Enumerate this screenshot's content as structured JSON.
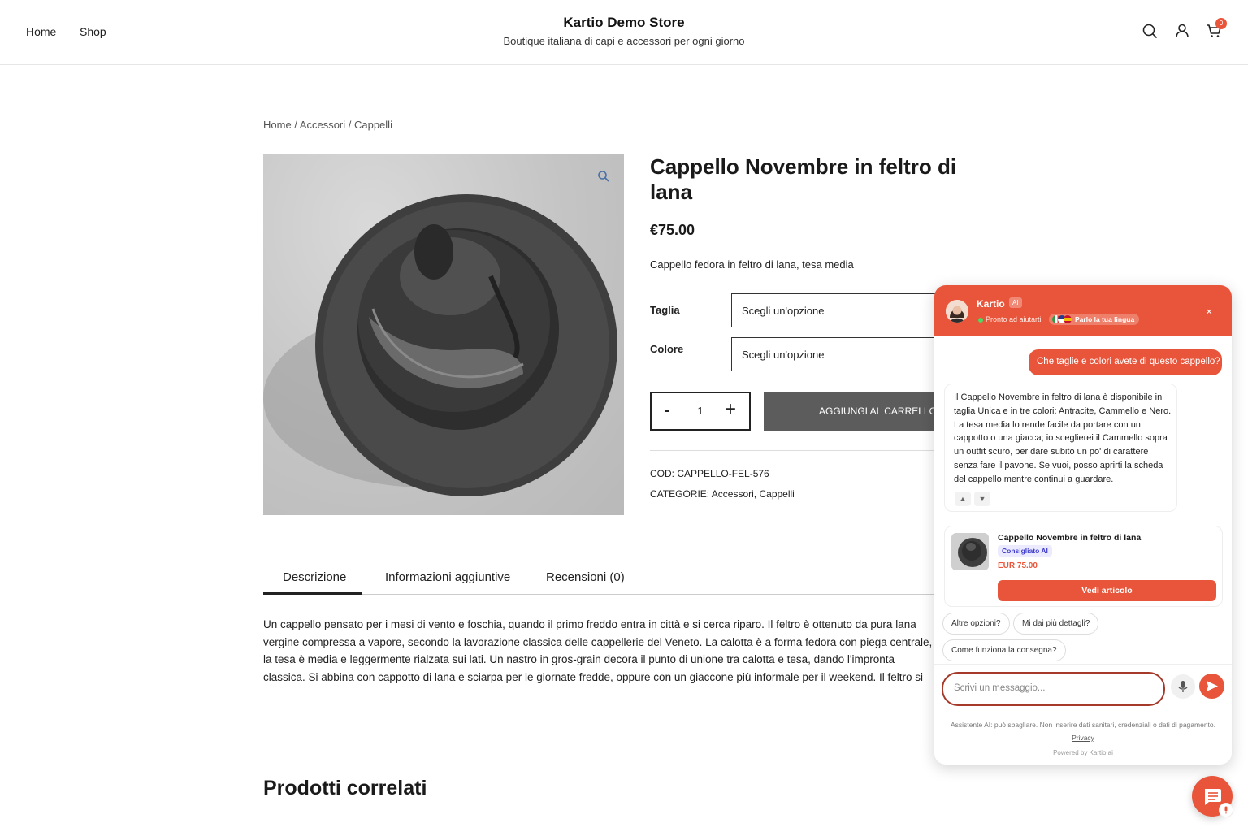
{
  "header": {
    "nav": [
      "Home",
      "Shop"
    ],
    "store_title": "Kartio Demo Store",
    "store_tagline": "Boutique italiana di capi e accessori per ogni giorno",
    "cart_count": "0"
  },
  "breadcrumb": "Home / Accessori / Cappelli",
  "product": {
    "title": "Cappello Novembre in feltro di lana",
    "price": "€75.00",
    "short_description": "Cappello fedora in feltro di lana, tesa media",
    "attributes": [
      {
        "label": "Taglia",
        "value": "Scegli un'opzione"
      },
      {
        "label": "Colore",
        "value": "Scegli un'opzione"
      }
    ],
    "quantity": "1",
    "qty_minus": "-",
    "qty_plus": "+",
    "add_to_cart": "AGGIUNGI AL CARRELLO",
    "sku_line": "COD: CAPPELLO-FEL-576",
    "categories_line": "CATEGORIE: Accessori, Cappelli"
  },
  "tabs": [
    "Descrizione",
    "Informazioni aggiuntive",
    "Recensioni (0)"
  ],
  "description_text": "Un cappello pensato per i mesi di vento e foschia, quando il primo freddo entra in città e si cerca riparo. Il feltro è ottenuto da pura lana vergine compressa a vapore, secondo la lavorazione classica delle cappellerie del Veneto. La calotta è a forma fedora con piega centrale, la tesa è media e leggermente rialzata sui lati. Un nastro in gros-grain decora il punto di unione tra calotta e tesa, dando l'impronta classica. Si abbina con cappotto di lana e sciarpa per le giornate fredde, oppure con un giaccone più informale per il weekend. Il feltro si modella sulla testa con il tempo, rendendolo ogni stagione più adatto.",
  "related_title": "Prodotti correlati",
  "chat": {
    "bot_name": "Kartio",
    "ai_tag": "AI",
    "status": "Pronto ad aiutarti",
    "lang_pill": "Parlo la tua lingua",
    "close": "×",
    "user_message": "Che taglie e colori avete di questo cappello?",
    "bot_message": "Il Cappello Novembre in feltro di lana è disponibile in taglia Unica e in tre colori: Antracite, Cammello e Nero. La tesa media lo rende facile da portare con un cappotto o una giacca; io sceglierei il Cammello sopra un outfit scuro, per dare subito un po' di carattere senza fare il pavone. Se vuoi, posso aprirti la scheda del cappello mentre continui a guardare.",
    "card": {
      "title": "Cappello Novembre in feltro di lana",
      "badge": "Consigliato AI",
      "price": "EUR 75.00",
      "button": "Vedi articolo"
    },
    "chips": [
      "Altre opzioni?",
      "Mi dai più dettagli?",
      "Come funziona la consegna?"
    ],
    "input_placeholder": "Scrivi un messaggio...",
    "disclaimer": "Assistente AI: può sbagliare. Non inserire dati sanitari, credenziali o dati di pagamento.",
    "privacy": "Privacy",
    "powered_by": "Powered by Kartio.ai"
  },
  "colors": {
    "accent": "#e8553a",
    "button_dark": "#5c5c5c",
    "badge_bg": "#ebeaff"
  }
}
